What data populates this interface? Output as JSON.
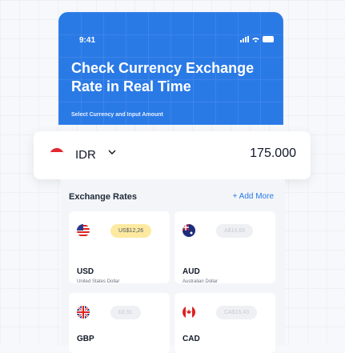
{
  "status_bar": {
    "time": "9:41"
  },
  "hero": {
    "title": "Check Currency Exchange Rate in Real Time",
    "subtitle": "Select Currency and Input Amount",
    "color": "#2a7ae6"
  },
  "selector": {
    "currency": "IDR",
    "amount": "175.000"
  },
  "rates": {
    "title": "Exchange Rates",
    "add_more": "+ Add More",
    "cards": [
      {
        "code": "USD",
        "name": "United States Dollar",
        "rate": "US$12,26",
        "highlighted": true,
        "flag": "us-flag-icon"
      },
      {
        "code": "AUD",
        "name": "Australian Dollar",
        "rate": "A$16,69",
        "highlighted": false,
        "flag": "au-flag-icon"
      },
      {
        "code": "GBP",
        "name": "",
        "rate": "£8,91",
        "highlighted": false,
        "flag": "gb-flag-icon"
      },
      {
        "code": "CAD",
        "name": "",
        "rate": "CA$15,43",
        "highlighted": false,
        "flag": "ca-flag-icon"
      }
    ]
  }
}
